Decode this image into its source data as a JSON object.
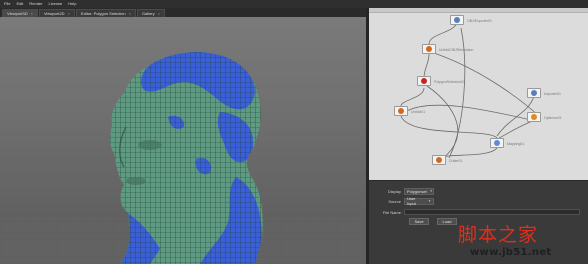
{
  "menubar": {
    "items": [
      "File",
      "Edit",
      "Render",
      "License",
      "Help"
    ]
  },
  "tabs": [
    {
      "label": "Viewport3D",
      "active": true
    },
    {
      "label": "Viewport2D",
      "active": false
    },
    {
      "label": "Editor: Polygon Selection",
      "active": false
    },
    {
      "label": "Gallery",
      "active": false
    }
  ],
  "graph": {
    "nodes": [
      {
        "label": "OBJ/Exporter01",
        "icon": "export-icon",
        "color": "#5a7fb8"
      },
      {
        "label": "Unfold/OBJRelaxation",
        "icon": "relax-icon",
        "color": "#d2691e"
      },
      {
        "label": "PolygonSelection01",
        "icon": "forbidden-icon",
        "color": "#cc2222"
      },
      {
        "label": "Unfold01",
        "icon": "unfold-icon",
        "color": "#d2691e"
      },
      {
        "label": "Importer01",
        "icon": "import-icon",
        "color": "#5a7fb8"
      },
      {
        "label": "Optimize01",
        "icon": "optimize-icon",
        "color": "#e08b1a"
      },
      {
        "label": "Mapping01",
        "icon": "mapping-icon",
        "color": "#5a8fd8"
      },
      {
        "label": "Cutter01",
        "icon": "cutter-icon",
        "color": "#d2691e"
      }
    ]
  },
  "properties": {
    "display_label": "Display",
    "display_value": "Polygonset",
    "source_label": "Source",
    "source_value": "User Input",
    "filename_label": "File Name",
    "save_label": "Save",
    "load_label": "Load"
  },
  "watermark": {
    "title": "脚本之家",
    "subtitle": "www.jb51.net",
    "title_color": "#e02f1c"
  },
  "colors": {
    "mesh_green": "#5f9b82",
    "mesh_blue": "#3a5fd6",
    "viewport_bg": "#6f6f6f",
    "graph_bg": "#dcdcdc",
    "panel_bg": "#3a3a3a"
  }
}
